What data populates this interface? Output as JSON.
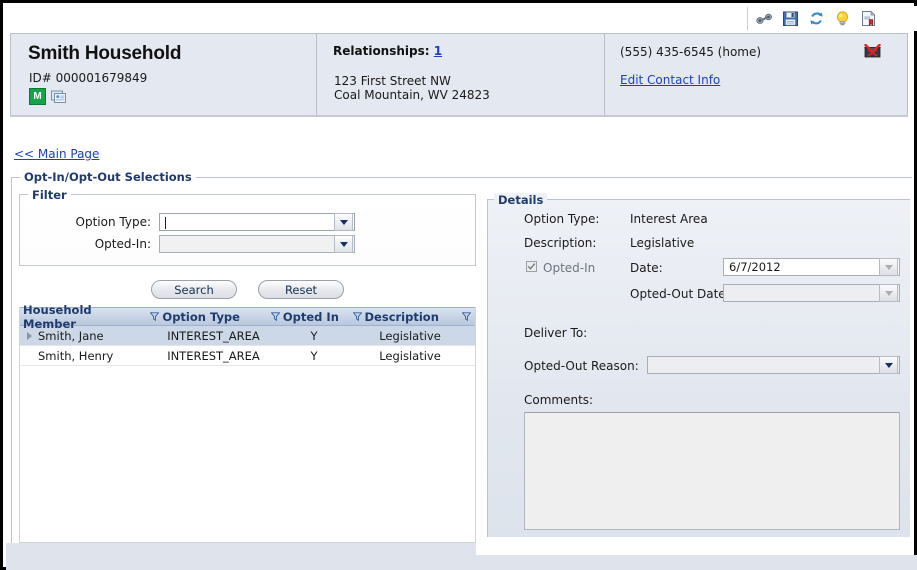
{
  "toolbar": {
    "icons": [
      {
        "name": "binoculars-icon",
        "label": "Search Records"
      },
      {
        "name": "save-icon",
        "label": "Save"
      },
      {
        "name": "refresh-icon",
        "label": "Refresh"
      },
      {
        "name": "lightbulb-icon",
        "label": "Hints"
      },
      {
        "name": "report-icon",
        "label": "Reports"
      }
    ]
  },
  "header": {
    "household_name": "Smith Household",
    "id_label": "ID# 000001679849",
    "badge_m": "M",
    "card_icon_name": "contact-card-icon",
    "relationships_label": "Relationships:",
    "relationships_count": "1",
    "address_line1": "123 First Street NW",
    "address_line2": "Coal Mountain, WV 24823",
    "phone": "(555) 435-6545 (home)",
    "edit_contact_link": "Edit Contact Info",
    "no_mail_icon_name": "do-not-mail-icon"
  },
  "nav": {
    "main_page_link": "<< Main Page"
  },
  "sections": {
    "outer_legend": "Opt-In/Opt-Out Selections",
    "filter_legend": "Filter",
    "details_legend": "Details"
  },
  "filter": {
    "option_type_label": "Option Type:",
    "option_type_value": "",
    "opted_in_label": "Opted-In:",
    "opted_in_value": "",
    "search_button": "Search",
    "reset_button": "Reset"
  },
  "grid": {
    "columns": [
      {
        "label": "Household Member",
        "filterable": false
      },
      {
        "label": "Option Type",
        "filterable": true
      },
      {
        "label": "Opted In",
        "filterable": true
      },
      {
        "label": "Description",
        "filterable": true
      }
    ],
    "rows": [
      {
        "household_member": "Smith, Jane",
        "option_type": "INTEREST_AREA",
        "opted_in": "Y",
        "description": "Legislative",
        "selected": true
      },
      {
        "household_member": "Smith, Henry",
        "option_type": "INTEREST_AREA",
        "opted_in": "Y",
        "description": "Legislative",
        "selected": false
      }
    ]
  },
  "details": {
    "option_type_label": "Option Type:",
    "option_type_value": "Interest Area",
    "description_label": "Description:",
    "description_value": "Legislative",
    "opted_in_label": "Opted-In",
    "opted_in_checked": true,
    "date_label": "Date:",
    "date_value": "6/7/2012",
    "opted_out_date_label": "Opted-Out Date:",
    "opted_out_date_value": "",
    "deliver_to_label": "Deliver To:",
    "opted_out_reason_label": "Opted-Out Reason:",
    "opted_out_reason_value": "",
    "comments_label": "Comments:",
    "comments_value": ""
  },
  "colors": {
    "link": "#1a3fc4",
    "legend": "#1f3b6e",
    "grid_header_top": "#d9e2ef",
    "grid_header_bottom": "#b9c8de",
    "row_selected": "#ccd8e8",
    "header_card_bg": "#e4e8f0",
    "badge_green": "#16a34a"
  }
}
